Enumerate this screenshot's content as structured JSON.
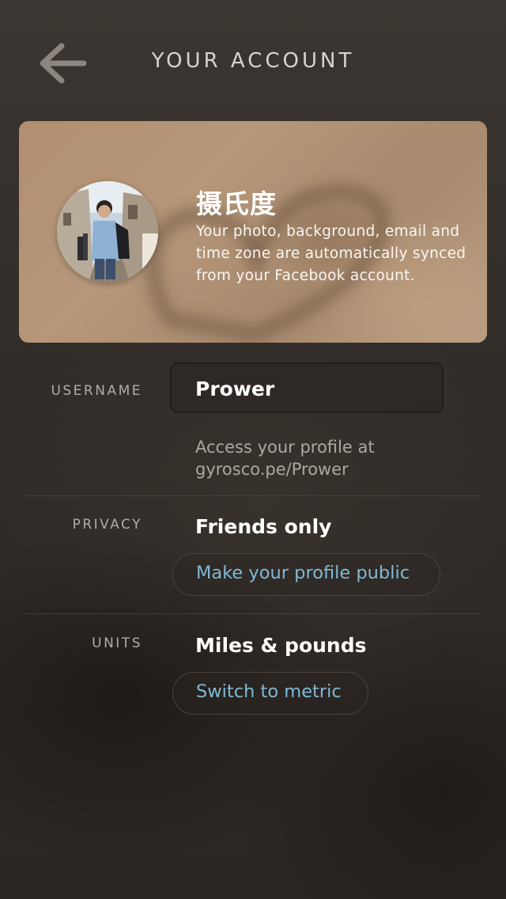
{
  "header": {
    "title": "YOUR ACCOUNT",
    "back_icon": "arrow-left-icon"
  },
  "profile": {
    "name": "摄氏度",
    "note": "Your photo, background, email and time zone are automatically synced from your Facebook account.",
    "avatar_icon": "user-photo"
  },
  "settings": {
    "username": {
      "label": "USERNAME",
      "value": "Prower",
      "hint": "Access your profile at gyrosco.pe/Prower"
    },
    "privacy": {
      "label": "PRIVACY",
      "value": "Friends only",
      "action": "Make your profile public"
    },
    "units": {
      "label": "UNITS",
      "value": "Miles & pounds",
      "action": "Switch to metric"
    }
  },
  "colors": {
    "accent_link": "#80b9d6",
    "background": "#2d2824",
    "card": "#b28f6f"
  }
}
